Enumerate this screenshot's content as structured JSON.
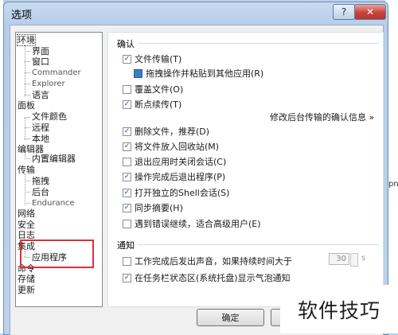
{
  "window": {
    "title": "选项",
    "help_label": "?",
    "close_label": "✕"
  },
  "tree": [
    {
      "label": "环境"
    },
    {
      "label": "界面"
    },
    {
      "label": "窗口"
    },
    {
      "label": "Commander"
    },
    {
      "label": "Explorer"
    },
    {
      "label": "语言"
    },
    {
      "label": "面板"
    },
    {
      "label": "文件颜色"
    },
    {
      "label": "远程"
    },
    {
      "label": "本地"
    },
    {
      "label": "编辑器"
    },
    {
      "label": "内置编辑器"
    },
    {
      "label": "传输"
    },
    {
      "label": "拖拽"
    },
    {
      "label": "后台"
    },
    {
      "label": "Endurance"
    },
    {
      "label": "网络"
    },
    {
      "label": "安全"
    },
    {
      "label": "日志"
    },
    {
      "label": "集成"
    },
    {
      "label": "应用程序"
    },
    {
      "label": "命令"
    },
    {
      "label": "存储"
    },
    {
      "label": "更新"
    }
  ],
  "sections": {
    "confirm": "确认",
    "notify": "通知"
  },
  "options": [
    {
      "label": "文件传输(T)",
      "checked": true
    },
    {
      "label": "拖拽操作并粘贴到其他应用(R)",
      "checked": true
    },
    {
      "label": "覆盖文件(O)",
      "checked": false
    },
    {
      "label": "断点续传(T)",
      "checked": true
    },
    {
      "label": "删除文件，推荐(D)",
      "checked": true
    },
    {
      "label": "将文件放入回收站(M)",
      "checked": true
    },
    {
      "label": "退出应用时关闭会话(C)",
      "checked": false
    },
    {
      "label": "操作完成后退出程序(P)",
      "checked": true
    },
    {
      "label": "打开独立的Shell会话(S)",
      "checked": true
    },
    {
      "label": "同步摘要(H)",
      "checked": true
    },
    {
      "label": "遇到错误继续，适合高级用户(E)",
      "checked": false
    },
    {
      "label": "工作完成后发出声音，如果持续时间大于",
      "checked": false
    },
    {
      "label": "在任务栏状态区(系统托盘)显示气泡通知",
      "checked": true
    }
  ],
  "background_confirm_link": "修改后台传输的确认信息 »",
  "sound_duration": {
    "value": "30",
    "unit": "s"
  },
  "buttons": {
    "ok": "确定"
  },
  "watermark": "软件技巧",
  "side_text": "pn",
  "colors": {
    "highlight_box": "#d9323a",
    "title_gradient": "#c7dbf1"
  }
}
